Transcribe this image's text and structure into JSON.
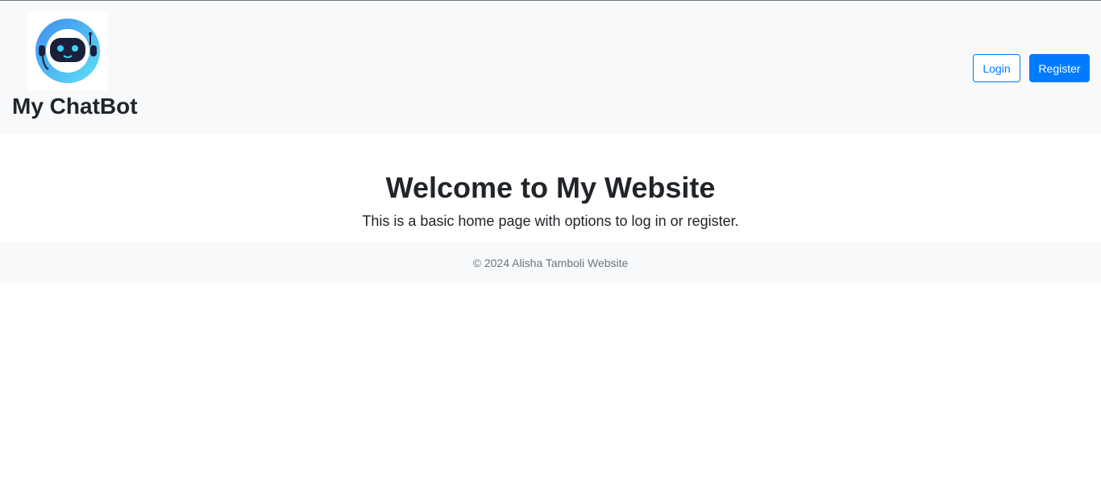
{
  "navbar": {
    "brand_name": "My ChatBot",
    "logo_icon": "robot-icon",
    "login_label": "Login",
    "register_label": "Register"
  },
  "main": {
    "headline": "Welcome to My Website",
    "lead": "This is a basic home page with options to log in or register."
  },
  "footer": {
    "text": "© 2024 Alisha Tamboli Website"
  },
  "colors": {
    "primary": "#007bff",
    "navbar_bg": "#f8f9fa",
    "text": "#212529",
    "muted": "#6c757d"
  }
}
